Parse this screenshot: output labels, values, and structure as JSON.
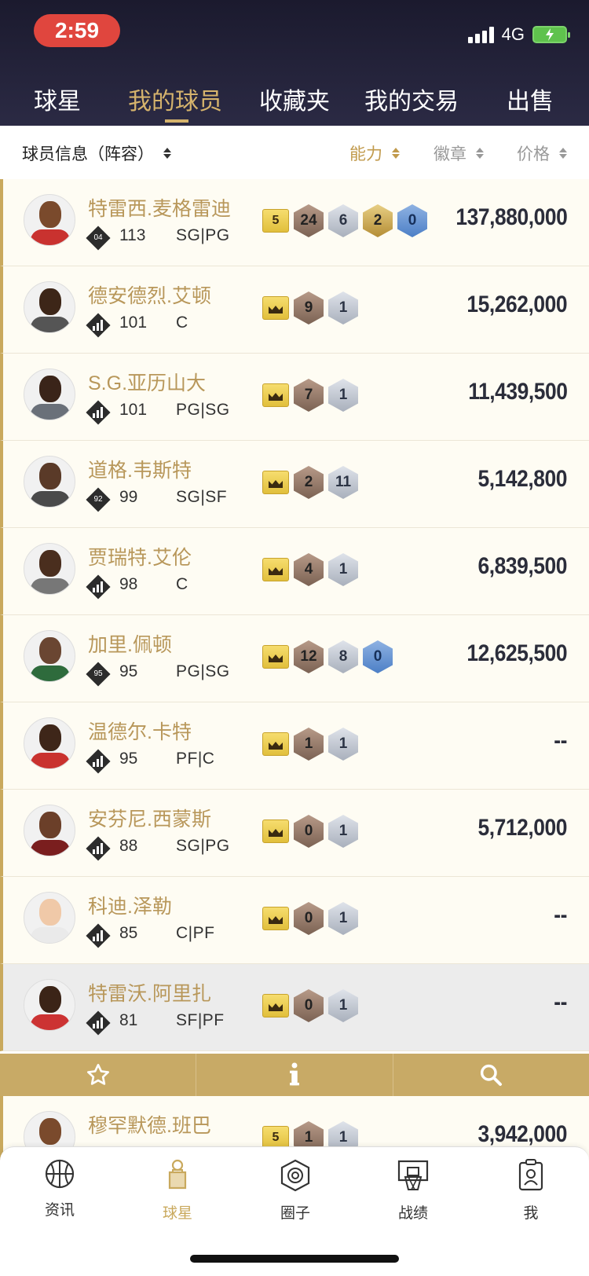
{
  "status_bar": {
    "time": "2:59",
    "network": "4G"
  },
  "tabs": [
    {
      "label": "球星",
      "active": false
    },
    {
      "label": "我的球员",
      "active": true
    },
    {
      "label": "收藏夹",
      "active": false
    },
    {
      "label": "我的交易",
      "active": false
    },
    {
      "label": "出售",
      "active": false
    }
  ],
  "sort_bar": {
    "info_label": "球员信息（阵容）",
    "ability": "能力",
    "badge": "徽章",
    "price": "价格"
  },
  "players": [
    {
      "name": "特雷西.麦格雷迪",
      "tier": "04",
      "ovr": "113",
      "pos": "SG|PG",
      "rank_chip": "5",
      "badges": [
        {
          "t": "bronze",
          "v": "24"
        },
        {
          "t": "silver",
          "v": "6"
        },
        {
          "t": "gold",
          "v": "2"
        },
        {
          "t": "hof",
          "v": "0"
        }
      ],
      "price": "137,880,000"
    },
    {
      "name": "德安德烈.艾顿",
      "tier": "",
      "ovr": "101",
      "pos": "C",
      "rank_chip": "",
      "badges": [
        {
          "t": "bronze",
          "v": "9"
        },
        {
          "t": "silver",
          "v": "1"
        }
      ],
      "price": "15,262,000"
    },
    {
      "name": "S.G.亚历山大",
      "tier": "",
      "ovr": "101",
      "pos": "PG|SG",
      "rank_chip": "",
      "badges": [
        {
          "t": "bronze",
          "v": "7"
        },
        {
          "t": "silver",
          "v": "1"
        }
      ],
      "price": "11,439,500"
    },
    {
      "name": "道格.韦斯特",
      "tier": "92",
      "ovr": "99",
      "pos": "SG|SF",
      "rank_chip": "",
      "badges": [
        {
          "t": "bronze",
          "v": "2"
        },
        {
          "t": "silver",
          "v": "11"
        }
      ],
      "price": "5,142,800"
    },
    {
      "name": "贾瑞特.艾伦",
      "tier": "",
      "ovr": "98",
      "pos": "C",
      "rank_chip": "",
      "badges": [
        {
          "t": "bronze",
          "v": "4"
        },
        {
          "t": "silver",
          "v": "1"
        }
      ],
      "price": "6,839,500"
    },
    {
      "name": "加里.佩顿",
      "tier": "95",
      "ovr": "95",
      "pos": "PG|SG",
      "rank_chip": "",
      "badges": [
        {
          "t": "bronze",
          "v": "12"
        },
        {
          "t": "silver",
          "v": "8"
        },
        {
          "t": "hof",
          "v": "0"
        }
      ],
      "price": "12,625,500"
    },
    {
      "name": "温德尔.卡特",
      "tier": "",
      "ovr": "95",
      "pos": "PF|C",
      "rank_chip": "",
      "badges": [
        {
          "t": "bronze",
          "v": "1"
        },
        {
          "t": "silver",
          "v": "1"
        }
      ],
      "price": "--"
    },
    {
      "name": "安芬尼.西蒙斯",
      "tier": "",
      "ovr": "88",
      "pos": "SG|PG",
      "rank_chip": "",
      "badges": [
        {
          "t": "bronze",
          "v": "0"
        },
        {
          "t": "silver",
          "v": "1"
        }
      ],
      "price": "5,712,000"
    },
    {
      "name": "科迪.泽勒",
      "tier": "",
      "ovr": "85",
      "pos": "C|PF",
      "rank_chip": "",
      "badges": [
        {
          "t": "bronze",
          "v": "0"
        },
        {
          "t": "silver",
          "v": "1"
        }
      ],
      "price": "--"
    },
    {
      "name": "特雷沃.阿里扎",
      "tier": "",
      "ovr": "81",
      "pos": "SF|PF",
      "rank_chip": "",
      "badges": [
        {
          "t": "bronze",
          "v": "0"
        },
        {
          "t": "silver",
          "v": "1"
        }
      ],
      "price": "--",
      "selected": true
    }
  ],
  "partial_player": {
    "name": "穆罕默德.班巴",
    "rank_chip": "5",
    "badges": [
      {
        "t": "bronze",
        "v": "1"
      },
      {
        "t": "silver",
        "v": "1"
      }
    ],
    "price": "3,942,000"
  },
  "bottom_nav": [
    {
      "label": "资讯",
      "icon": "basketball-icon"
    },
    {
      "label": "球星",
      "icon": "player-card-icon",
      "active": true
    },
    {
      "label": "圈子",
      "icon": "circle-icon"
    },
    {
      "label": "战绩",
      "icon": "hoop-icon"
    },
    {
      "label": "我",
      "icon": "profile-icon"
    }
  ],
  "colors": {
    "gold": "#c8aa66",
    "header": "#1b1a2e",
    "accent_text": "#d5b36c"
  }
}
